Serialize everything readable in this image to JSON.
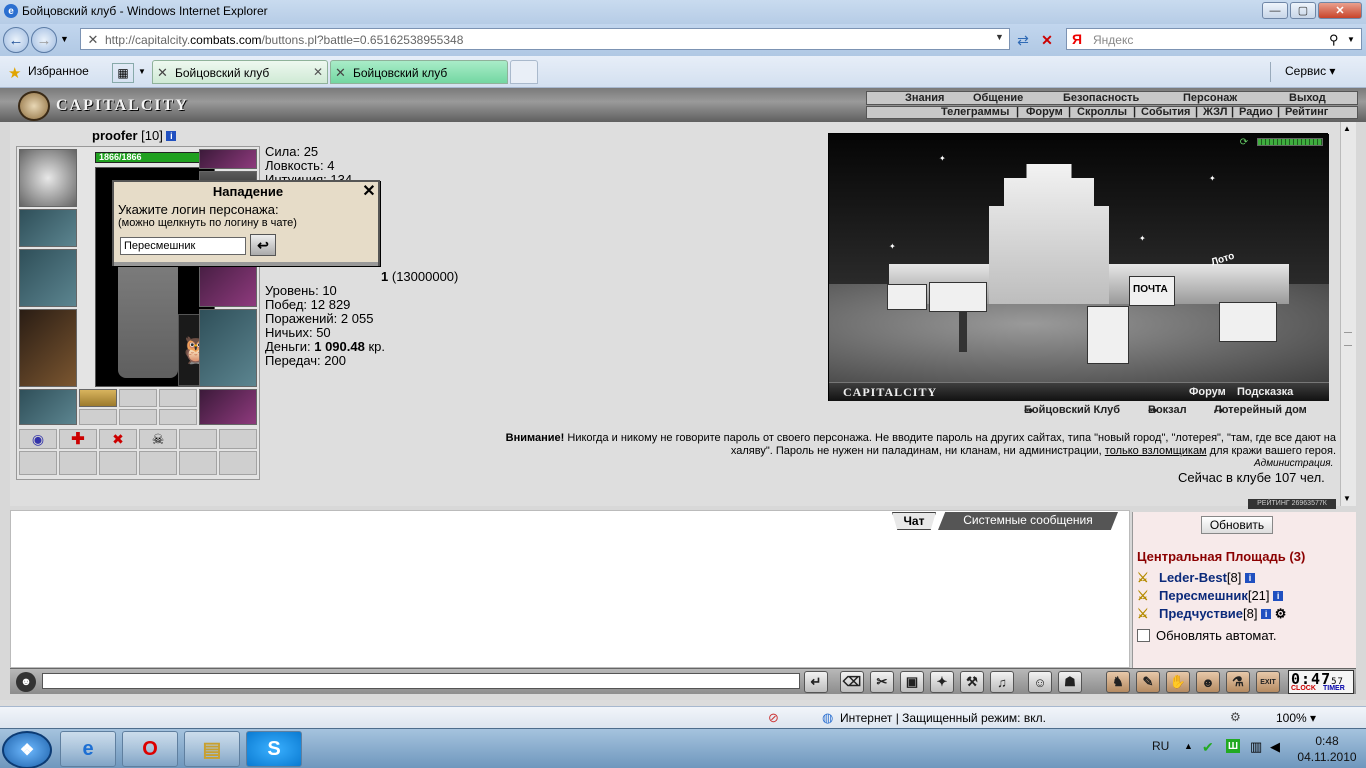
{
  "window": {
    "title": "Бойцовский клуб - Windows Internet Explorer",
    "minimize": "—",
    "maximize": "▢",
    "close": "✕"
  },
  "address": {
    "prefix": "http://capitalcity.",
    "domain": "combats.com",
    "path": "/buttons.pl?battle=0.65162538955348"
  },
  "search": {
    "engine_glyph": "Я",
    "placeholder": "Яндекс"
  },
  "favorites": {
    "label": "Избранное"
  },
  "tabs": [
    {
      "label": "Бойцовский клуб"
    },
    {
      "label": "Бойцовский клуб"
    }
  ],
  "service_menu": "Сервис ▾",
  "game": {
    "logo": "CAPITALCITY",
    "menu_top": [
      "Знания",
      "Общение",
      "Безопасность",
      "Персонаж",
      "Выход"
    ],
    "menu_bottom": [
      "Телеграммы",
      "Форум",
      "Скроллы",
      "События",
      "ЖЗЛ",
      "Радио",
      "Рейтинг"
    ],
    "menu_sep": "|",
    "char": {
      "name": "proofer",
      "level": "[10]",
      "hp": "1866/1866"
    },
    "stats_top": [
      {
        "label": "Сила:",
        "value": "25"
      },
      {
        "label": "Ловкость:",
        "value": "4"
      },
      {
        "label": "Интуиция:",
        "value": "134"
      }
    ],
    "exp_fragment": "1",
    "exp_total": "(13000000)",
    "stats": [
      {
        "label": "Уровень:",
        "value": "10"
      },
      {
        "label": "Побед:",
        "value": "12 829"
      },
      {
        "label": "Поражений:",
        "value": "2 055"
      },
      {
        "label": "Ничьих:",
        "value": "50"
      }
    ],
    "money_label": "Деньги:",
    "money_value": "1 090.48",
    "money_unit": "кр.",
    "transfers_label": "Передач:",
    "transfers_value": "200",
    "info_glyph": "i",
    "dialog": {
      "title": "Нападение",
      "close": "✕",
      "prompt": "Укажите логин персонажа:",
      "hint": "(можно щелкнуть по логину в чате)",
      "input_value": "Пересмешник",
      "ok_glyph": "↩"
    },
    "city": {
      "name": "CAPITALCITY",
      "forum": "Форум",
      "hint": "Подсказка",
      "sign_post": "ПОЧТА",
      "sign_loto": "Лото",
      "places": [
        "Бойцовский Клуб",
        "Вокзал",
        "Лотерейный дом"
      ],
      "place_arrow": "⇢"
    },
    "warning": {
      "bold": "Внимание!",
      "text": " Никогда и никому не говорите пароль от своего персонажа. Не вводите пароль на других сайтах, типа \"новый город\", \"лотерея\", \"там, где все дают на халяву\". Пароль не нужен ни паладинам, ни кланам, ни администрации, ",
      "link": "только взломщикам",
      "tail": " для кражи вашего героя."
    },
    "admin": "Администрация.",
    "online_label": "Сейчас в клубе 107 чел.",
    "rating": "РЕЙТИНГ 26963577К"
  },
  "chat": {
    "tab_chat": "Чат",
    "tab_system": "Системные сообщения",
    "refresh": "Обновить",
    "room": "Центральная Площадь (3)",
    "users": [
      {
        "name": "Leder-Best",
        "level": "[8]"
      },
      {
        "name": "Пересмешник",
        "level": "[21]"
      },
      {
        "name": "Предчуствие",
        "level": "[8]"
      }
    ],
    "user_marker": "⚔",
    "auto_refresh": "Обновлять автомат."
  },
  "toolbar": {
    "buttons": [
      "↵",
      "⌫",
      "✂",
      "▣",
      "✦",
      "⚒",
      "♫",
      "☺",
      "☗"
    ],
    "buttons_right": [
      "♞",
      "✎",
      "✋",
      "☻",
      "⚗",
      "EXIT"
    ],
    "clock_time": "0:47",
    "clock_sec": "57",
    "clock_label": "CLOCK",
    "timer_label": "TIMER"
  },
  "status": {
    "zone": "Интернет | Защищенный режим: вкл.",
    "zoom": "100% ▾"
  },
  "taskbar": {
    "start_glyph": "❖",
    "apps": [
      "e",
      "O",
      "▤",
      "S"
    ],
    "lang": "RU",
    "time": "0:48",
    "date": "04.11.2010"
  }
}
